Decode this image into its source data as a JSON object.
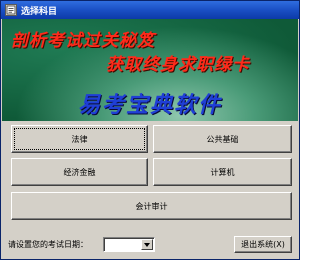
{
  "window": {
    "title": "选择科目",
    "icon": "app-window-icon"
  },
  "banner": {
    "slogan_line1": "剖析考试过关秘笈",
    "slogan_line2": "获取终身求职绿卡",
    "brand": "易考宝典软件",
    "colors": {
      "slogan": "#ff2a1a",
      "brand": "#1f3fd6",
      "background": "#0e5c3a"
    }
  },
  "subjects": {
    "law": "法律",
    "public_basics": "公共基础",
    "finance": "经济金融",
    "computer": "计算机",
    "accounting_audit": "会计审计"
  },
  "bottom": {
    "date_label": "请设置您的考试日期：",
    "date_value": "",
    "exit_label": "退出系统(X)"
  }
}
